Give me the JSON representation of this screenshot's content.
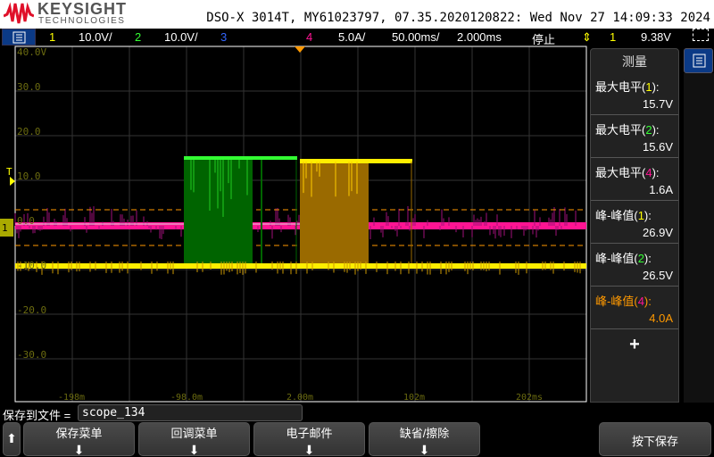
{
  "brand": {
    "name": "KEYSIGHT",
    "sub": "TECHNOLOGIES"
  },
  "title": "DSO-X 3014T, MY61023797, 07.35.2020120822: Wed Nov 27 14:09:33 2024",
  "status": {
    "ch1": {
      "num": "1",
      "scale": "10.0V/",
      "color": "#ffff00"
    },
    "ch2": {
      "num": "2",
      "scale": "10.0V/",
      "color": "#33ff33"
    },
    "ch3": {
      "num": "3",
      "color": "#3366ff"
    },
    "ch4": {
      "num": "4",
      "scale": "5.0A/",
      "color": "#ff1493"
    },
    "timebase": "50.00ms/",
    "delay": "2.000ms",
    "run_state": "停止",
    "trigger": {
      "source": "1",
      "level": "9.38V"
    }
  },
  "plot": {
    "y_labels": [
      "40.0V",
      "30.0",
      "20.0",
      "10.0",
      "0.0",
      "-10.0",
      "-20.0",
      "-30.0"
    ],
    "x_labels": [
      "-198m",
      "-98.0m",
      "2.00m",
      "102m",
      "202ms"
    ],
    "trigger_marker": "T",
    "ground_marker": "1"
  },
  "measurements": {
    "title": "测量",
    "items": [
      {
        "name": "最大电平",
        "ch": "1",
        "ch_color": "#ffff00",
        "value": "15.7V"
      },
      {
        "name": "最大电平",
        "ch": "2",
        "ch_color": "#33ff33",
        "value": "15.6V"
      },
      {
        "name": "最大电平",
        "ch": "4",
        "ch_color": "#ff1493",
        "value": "1.6A"
      },
      {
        "name": "峰-峰值",
        "ch": "1",
        "ch_color": "#ffff00",
        "value": "26.9V"
      },
      {
        "name": "峰-峰值",
        "ch": "2",
        "ch_color": "#33ff33",
        "value": "26.5V"
      },
      {
        "name": "峰-峰值",
        "ch": "4",
        "ch_color": "#ff1493",
        "value": "4.0A",
        "highlight": "#ff9900"
      }
    ],
    "add": "+"
  },
  "save": {
    "label": "保存到文件 =",
    "filename": "scope_134"
  },
  "softkeys": [
    "保存菜单",
    "回调菜单",
    "电子邮件",
    "缺省/擦除"
  ],
  "press_save": "按下保存"
}
